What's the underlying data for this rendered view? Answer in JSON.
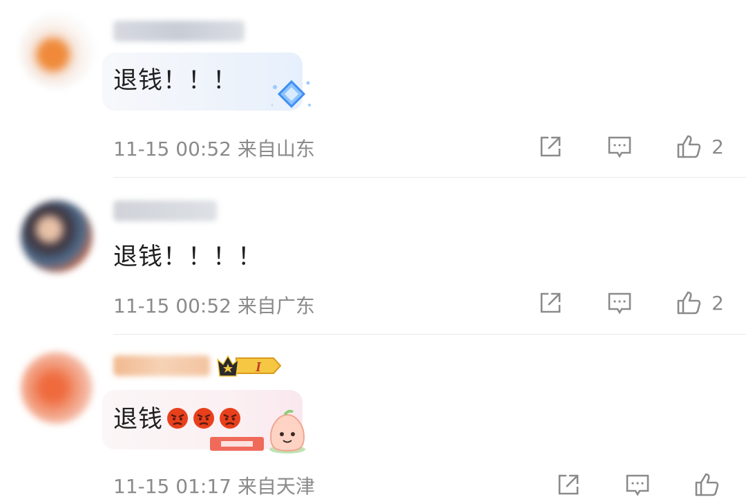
{
  "comments": [
    {
      "text": "退钱！！！",
      "timestamp": "11-15 00:52",
      "location": "来自山东",
      "like_count": "2"
    },
    {
      "text": "退钱！！！！",
      "timestamp": "11-15 00:52",
      "location": "来自广东",
      "like_count": "2"
    },
    {
      "text": "退钱",
      "emoji_count": 3,
      "emoji_name": "angry-face",
      "timestamp": "11-15 01:17",
      "location": "来自天津",
      "like_count": "",
      "badge_level": "I"
    }
  ],
  "icons": [
    "share-icon",
    "comment-icon",
    "like-icon"
  ],
  "colors": {
    "text": "#1e1e1e",
    "meta": "#8a8a8a",
    "divider": "#e9e9e9",
    "badge_gold": "#f5c742"
  }
}
